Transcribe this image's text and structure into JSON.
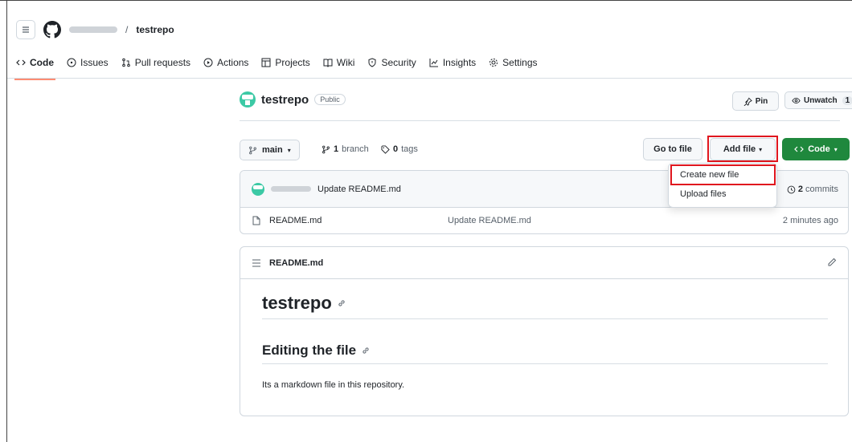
{
  "header": {
    "separator": "/",
    "repo": "testrepo",
    "tabs": [
      {
        "label": "Code",
        "icon": "code-icon"
      },
      {
        "label": "Issues",
        "icon": "issue-icon"
      },
      {
        "label": "Pull requests",
        "icon": "pull-request-icon"
      },
      {
        "label": "Actions",
        "icon": "play-icon"
      },
      {
        "label": "Projects",
        "icon": "table-icon"
      },
      {
        "label": "Wiki",
        "icon": "book-icon"
      },
      {
        "label": "Security",
        "icon": "shield-icon"
      },
      {
        "label": "Insights",
        "icon": "graph-icon"
      },
      {
        "label": "Settings",
        "icon": "gear-icon"
      }
    ]
  },
  "repo": {
    "name": "testrepo",
    "visibility": "Public",
    "pin_label": "Pin",
    "unwatch_label": "Unwatch",
    "watch_count": "1"
  },
  "branchbar": {
    "branch": "main",
    "branch_count": "1",
    "branch_word": "branch",
    "tag_count": "0",
    "tag_word": "tags",
    "goto_label": "Go to file",
    "addfile_label": "Add file",
    "code_label": "Code"
  },
  "dropdown": {
    "items": [
      "Create new file",
      "Upload files"
    ]
  },
  "files": {
    "latest_commit_message": "Update README.md",
    "commit_count": "2",
    "commit_word": "commits",
    "rows": [
      {
        "name": "README.md",
        "commit": "Update README.md",
        "time": "2 minutes ago"
      }
    ]
  },
  "readme": {
    "filename": "README.md",
    "h1": "testrepo",
    "h2": "Editing the file",
    "paragraph": "Its a markdown file in this repository."
  },
  "colors": {
    "accent_green": "#1f883d",
    "highlight_red": "#e0161e",
    "tab_underline": "#fd8c73"
  }
}
